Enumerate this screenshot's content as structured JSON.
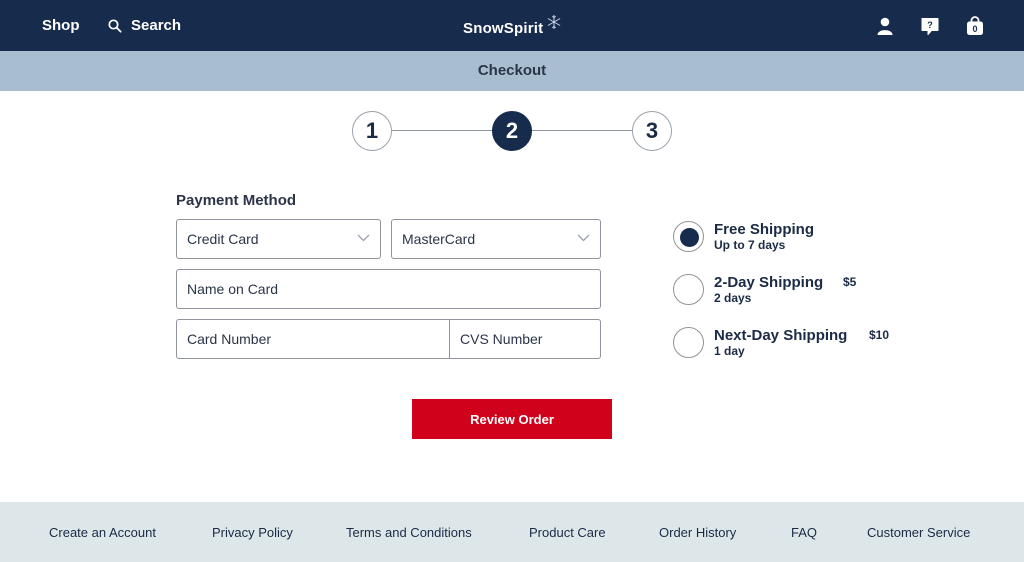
{
  "nav": {
    "shop_label": "Shop",
    "search_label": "Search",
    "brand": "SnowSpirit",
    "icons": [
      "user-icon",
      "help-icon",
      "bag-icon"
    ],
    "help_glyph": "?",
    "bag_count": "0"
  },
  "subheader": {
    "title": "Checkout"
  },
  "stepper": {
    "steps": [
      "1",
      "2",
      "3"
    ],
    "active_step": "2"
  },
  "payment": {
    "section_title": "Payment Method",
    "payment_type": "Credit Card",
    "card_brand": "MasterCard",
    "name_on_card_placeholder": "Name on Card",
    "card_number_placeholder": "Card Number",
    "cvs_placeholder": "CVS Number"
  },
  "shipping": {
    "options": [
      {
        "name": "Free Shipping",
        "detail": "Up to 7 days",
        "price": "",
        "selected": true
      },
      {
        "name": "2-Day Shipping",
        "detail": "2 days",
        "price": "$5",
        "selected": false
      },
      {
        "name": "Next-Day Shipping",
        "detail": "1 day",
        "price": "$10",
        "selected": false
      }
    ]
  },
  "actions": {
    "review_label": "Review Order"
  },
  "footer": {
    "links": [
      "Create an Account",
      "Privacy Policy",
      "Terms and Conditions",
      "Product Care",
      "Order History",
      "FAQ",
      "Customer Service"
    ]
  },
  "colors": {
    "navy": "#172c4d",
    "subheader": "#a9bdd1",
    "accent_red": "#d0021b",
    "footer_bg": "#dde7ea"
  }
}
